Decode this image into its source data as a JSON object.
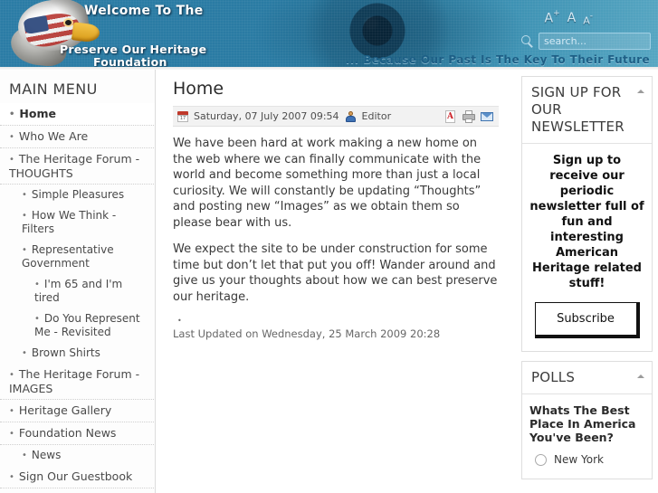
{
  "header": {
    "welcome": "Welcome To The",
    "org_line1": "Preserve Our Heritage",
    "org_line2": "Foundation",
    "tagline": "... Because Our Past Is The Key To Their Future",
    "fontsizer": {
      "increase": "A",
      "normal": "A",
      "decrease": "A",
      "increase_sup": "+",
      "decrease_sup": "-"
    },
    "search": {
      "placeholder": "search...",
      "value": ""
    }
  },
  "sidebar": {
    "title": "MAIN MENU",
    "items": [
      {
        "label": "Home",
        "level": 1,
        "active": true
      },
      {
        "label": "Who We Are",
        "level": 1,
        "active": false
      },
      {
        "label": "The Heritage Forum - THOUGHTS",
        "level": 1,
        "active": false
      },
      {
        "label": "Simple Pleasures",
        "level": 2,
        "active": false
      },
      {
        "label": "How We Think - Filters",
        "level": 2,
        "active": false
      },
      {
        "label": "Representative Government",
        "level": 2,
        "active": false
      },
      {
        "label": "I'm 65 and I'm tired",
        "level": 3,
        "active": false
      },
      {
        "label": "Do You Represent Me - Revisited",
        "level": 3,
        "active": false
      },
      {
        "label": "Brown Shirts",
        "level": 2,
        "active": false
      },
      {
        "label": "The Heritage Forum - IMAGES",
        "level": 1,
        "active": false
      },
      {
        "label": "Heritage Gallery",
        "level": 1,
        "active": false
      },
      {
        "label": "Foundation News",
        "level": 1,
        "active": false
      },
      {
        "label": "News",
        "level": 2,
        "active": false
      },
      {
        "label": "Sign Our Guestbook",
        "level": 1,
        "active": false
      }
    ],
    "bullet": "•"
  },
  "main": {
    "title": "Home",
    "info": {
      "date": "Saturday, 07 July 2007 09:54",
      "author": "Editor",
      "calendar_day": "17"
    },
    "paragraphs": [
      "We have been hard at work making a new home on the web where we can finally communicate with the world and become something more than just a local curiosity. We will constantly be updating “Thoughts” and posting new “Images” as we obtain them so please bear with us.",
      "We expect the site to be under construction for some time but don’t let that put you off!  Wander around and give us your thoughts about how we can best preserve our heritage."
    ],
    "list_bullet": "•",
    "last_updated": "Last Updated on Wednesday, 25 March 2009 20:28"
  },
  "rightbar": {
    "newsletter": {
      "title": "SIGN UP FOR OUR NEWSLETTER",
      "text": "Sign up to receive our periodic newsletter full of fun and interesting American Heritage related stuff!",
      "subscribe_label": "Subscribe"
    },
    "polls": {
      "title": "POLLS",
      "question": "Whats The Best Place In America You've Been?",
      "options": [
        {
          "label": "New York",
          "selected": false
        }
      ]
    }
  },
  "colors": {
    "header_blue": "#2a7ba3",
    "tagline_blue": "#1d5f86",
    "pdf_red": "#cc2027",
    "mail_blue": "#3f74b0",
    "info_bar_bg": "#f2f2f2"
  }
}
